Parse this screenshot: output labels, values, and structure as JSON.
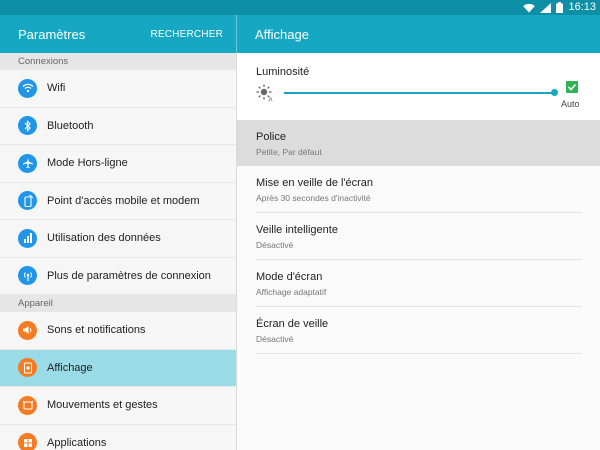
{
  "status_bar": {
    "time": "16:13",
    "icons": [
      "wifi-icon",
      "signal-icon",
      "battery-icon"
    ]
  },
  "header": {
    "title": "Paramètres",
    "search_label": "RECHERCHER",
    "detail_title": "Affichage"
  },
  "sidebar": {
    "sections": [
      {
        "header": "Connexions",
        "items": [
          {
            "label": "Wifi",
            "icon": "wifi-icon",
            "color": "#2196e8"
          },
          {
            "label": "Bluetooth",
            "icon": "bluetooth-icon",
            "color": "#2196e8"
          },
          {
            "label": "Mode Hors-ligne",
            "icon": "airplane-icon",
            "color": "#2196e8"
          },
          {
            "label": "Point d'accès mobile et modem",
            "icon": "hotspot-icon",
            "color": "#2196e8"
          },
          {
            "label": "Utilisation des données",
            "icon": "data-usage-icon",
            "color": "#2196e8"
          },
          {
            "label": "Plus de paramètres de connexion",
            "icon": "more-connections-icon",
            "color": "#2196e8"
          }
        ]
      },
      {
        "header": "Appareil",
        "items": [
          {
            "label": "Sons et notifications",
            "icon": "sound-icon",
            "color": "#f47b22"
          },
          {
            "label": "Affichage",
            "icon": "display-icon",
            "color": "#f47b22",
            "selected": true
          },
          {
            "label": "Mouvements et gestes",
            "icon": "motion-icon",
            "color": "#f47b22"
          },
          {
            "label": "Applications",
            "icon": "apps-icon",
            "color": "#f47b22"
          }
        ]
      }
    ]
  },
  "display_settings": {
    "brightness": {
      "label": "Luminosité",
      "level": 1.0,
      "auto_label": "Auto",
      "auto_checked": true
    },
    "items": [
      {
        "title": "Police",
        "subtitle": "Petite, Par défaut",
        "highlighted": true
      },
      {
        "title": "Mise en veille de l'écran",
        "subtitle": "Après 30 secondes d'inactivité"
      },
      {
        "title": "Veille intelligente",
        "subtitle": "Désactivé"
      },
      {
        "title": "Mode d'écran",
        "subtitle": "Affichage adaptatif"
      },
      {
        "title": "Écran de veille",
        "subtitle": "Désactivé"
      }
    ]
  },
  "colors": {
    "accent": "#16a8c2",
    "status_bar": "#0d8fa6",
    "selected_row": "#9adbe8",
    "connection_icon": "#2196e8",
    "device_icon": "#f47b22",
    "checkbox": "#2fb454"
  }
}
